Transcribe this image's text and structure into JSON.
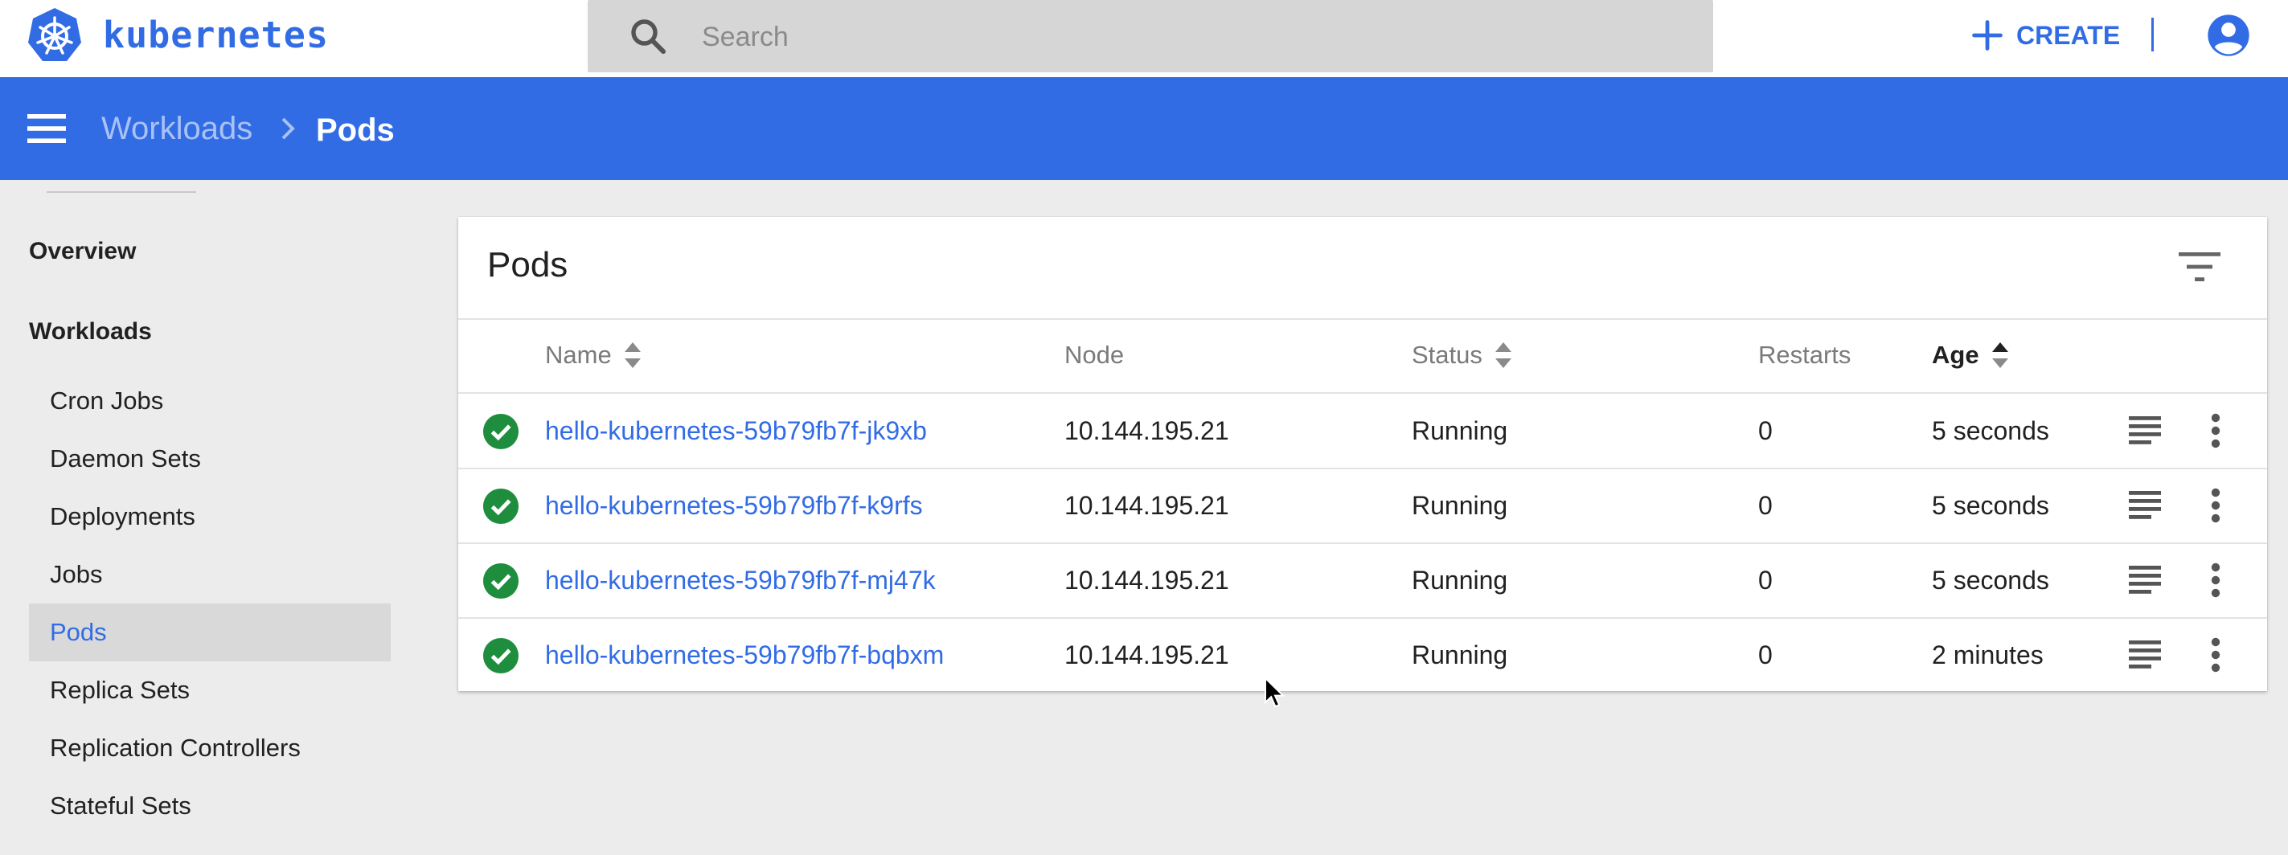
{
  "topbar": {
    "brand": "kubernetes",
    "search_placeholder": "Search",
    "create_label": "CREATE",
    "icons": {
      "logo": "kubernetes-helm-icon",
      "search": "search-icon",
      "create": "plus-icon",
      "account": "account-circle-icon"
    }
  },
  "header": {
    "breadcrumb": [
      "Workloads",
      "Pods"
    ],
    "icons": {
      "menu": "hamburger-menu-icon",
      "separator": "chevron-right-icon"
    }
  },
  "sidebar": {
    "overview_label": "Overview",
    "workloads_label": "Workloads",
    "items": [
      {
        "label": "Cron Jobs",
        "active": false
      },
      {
        "label": "Daemon Sets",
        "active": false
      },
      {
        "label": "Deployments",
        "active": false
      },
      {
        "label": "Jobs",
        "active": false
      },
      {
        "label": "Pods",
        "active": true
      },
      {
        "label": "Replica Sets",
        "active": false
      },
      {
        "label": "Replication Controllers",
        "active": false
      },
      {
        "label": "Stateful Sets",
        "active": false
      }
    ]
  },
  "pods_card": {
    "title": "Pods",
    "columns": [
      "Name",
      "Node",
      "Status",
      "Restarts",
      "Age"
    ],
    "sorted_by": "Age",
    "rows": [
      {
        "name": "hello-kubernetes-59b79fb7f-jk9xb",
        "node": "10.144.195.21",
        "status": "Running",
        "restarts": "0",
        "age": "5 seconds"
      },
      {
        "name": "hello-kubernetes-59b79fb7f-k9rfs",
        "node": "10.144.195.21",
        "status": "Running",
        "restarts": "0",
        "age": "5 seconds"
      },
      {
        "name": "hello-kubernetes-59b79fb7f-mj47k",
        "node": "10.144.195.21",
        "status": "Running",
        "restarts": "0",
        "age": "5 seconds"
      },
      {
        "name": "hello-kubernetes-59b79fb7f-bqbxm",
        "node": "10.144.195.21",
        "status": "Running",
        "restarts": "0",
        "age": "2 minutes"
      }
    ],
    "icons": {
      "filter": "filter-list-icon",
      "status": "check-circle-icon",
      "logs": "logs-icon",
      "more": "more-vert-icon",
      "sort": "sort-arrows-icon"
    }
  },
  "colors": {
    "accent": "#326ce5",
    "running": "#1e8e3e",
    "background": "#ececec",
    "active_item": "#d9d9d9"
  }
}
